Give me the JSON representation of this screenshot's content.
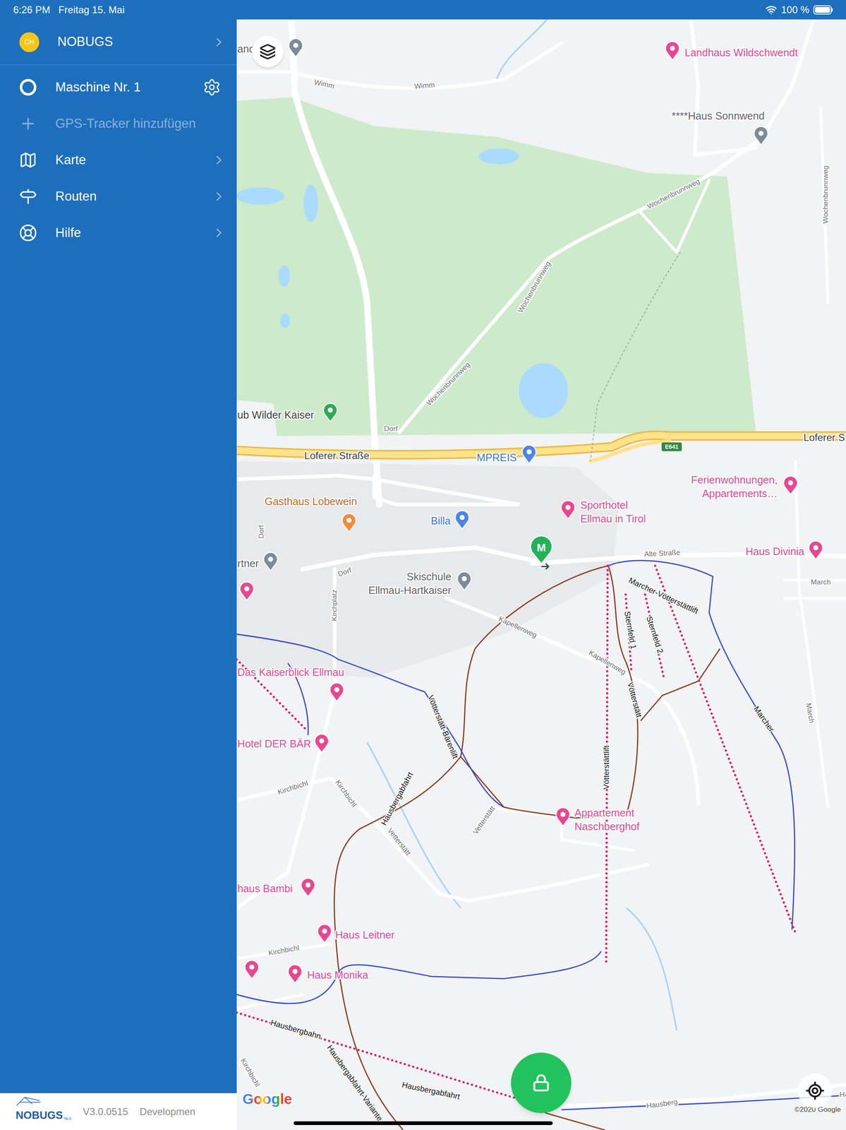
{
  "status_bar": {
    "time": "6:26 PM",
    "date": "Freitag 15. Mai",
    "battery": "100 %"
  },
  "sidebar": {
    "account": {
      "badge": "CH",
      "name": "NOBUGS"
    },
    "items": [
      {
        "label": "Maschine Nr. 1",
        "kind": "device",
        "disabled": false
      },
      {
        "label": "GPS-Tracker hinzufügen",
        "kind": "add",
        "disabled": true
      },
      {
        "label": "Karte",
        "kind": "map",
        "disabled": false
      },
      {
        "label": "Routen",
        "kind": "routes",
        "disabled": false
      },
      {
        "label": "Hilfe",
        "kind": "help",
        "disabled": false
      }
    ],
    "footer": {
      "logo": "NOBUGS",
      "logo_suffix": "NLS",
      "version": "V3.0.0515",
      "build": "Developmen"
    }
  },
  "map": {
    "marker": "M",
    "logo": "Google",
    "attribution": "©2020 Google",
    "labels": [
      {
        "text": "and",
        "kind": "place"
      },
      {
        "text": "Wimm",
        "kind": "road"
      },
      {
        "text": "Wimm",
        "kind": "road"
      },
      {
        "text": "Landhaus Wildschwendt",
        "kind": "lodging"
      },
      {
        "text": "****Haus Sonnwend",
        "kind": "place"
      },
      {
        "text": "Wochenbrunnweg",
        "kind": "road"
      },
      {
        "text": "Wochenbrunnweg",
        "kind": "road"
      },
      {
        "text": "Wochenbrunnweg",
        "kind": "road"
      },
      {
        "text": "Wochenbrunnweg",
        "kind": "road"
      },
      {
        "text": "ub Wilder Kaiser",
        "kind": "golf"
      },
      {
        "text": "Dorf",
        "kind": "road"
      },
      {
        "text": "Loferer Straße",
        "kind": "major_road"
      },
      {
        "text": "MPREIS",
        "kind": "shop"
      },
      {
        "text": "E641",
        "kind": "shield"
      },
      {
        "text": "Loferer S",
        "kind": "major_road"
      },
      {
        "text": "Ferienwohnungen,",
        "kind": "lodging"
      },
      {
        "text": "Appartements…",
        "kind": "lodging"
      },
      {
        "text": "Gasthaus Lobewein",
        "kind": "food"
      },
      {
        "text": "Sporthotel",
        "kind": "lodging"
      },
      {
        "text": "Ellmau in Tirol",
        "kind": "lodging"
      },
      {
        "text": "Billa",
        "kind": "shop"
      },
      {
        "text": "Dorf",
        "kind": "road"
      },
      {
        "text": "rtner",
        "kind": "place"
      },
      {
        "text": "Dorf",
        "kind": "road"
      },
      {
        "text": "Skischule",
        "kind": "place"
      },
      {
        "text": "Ellmau-Hartkaiser",
        "kind": "place"
      },
      {
        "text": "Alte Straße",
        "kind": "road"
      },
      {
        "text": "Haus Divinia",
        "kind": "lodging"
      },
      {
        "text": "March",
        "kind": "road"
      },
      {
        "text": "Kirchplatz",
        "kind": "road"
      },
      {
        "text": "Kapellenweg",
        "kind": "road"
      },
      {
        "text": "Kapellenweg",
        "kind": "road"
      },
      {
        "text": "Marcher-Vötterstättlift",
        "kind": "piste"
      },
      {
        "text": "Sternfeld 1",
        "kind": "piste"
      },
      {
        "text": "Sternfeld 2",
        "kind": "piste"
      },
      {
        "text": "Vötterstätt",
        "kind": "piste"
      },
      {
        "text": "Das Kaiserblick Ellmau",
        "kind": "lodging"
      },
      {
        "text": "Vötterstätt-Bärenlift",
        "kind": "piste"
      },
      {
        "text": "Marcher",
        "kind": "piste"
      },
      {
        "text": "March",
        "kind": "road"
      },
      {
        "text": "Hotel DER BÄR",
        "kind": "lodging"
      },
      {
        "text": "Vötterstättlift",
        "kind": "piste"
      },
      {
        "text": "Kirchbichl",
        "kind": "road"
      },
      {
        "text": "Kirchbichl",
        "kind": "road"
      },
      {
        "text": "Hausbergabfahrt",
        "kind": "piste"
      },
      {
        "text": "Vetterstätt",
        "kind": "road"
      },
      {
        "text": "Vetterstätt",
        "kind": "road"
      },
      {
        "text": "Appartement",
        "kind": "lodging"
      },
      {
        "text": "Naschberghof",
        "kind": "lodging"
      },
      {
        "text": "haus Bambi",
        "kind": "lodging"
      },
      {
        "text": "Haus Leitner",
        "kind": "lodging"
      },
      {
        "text": "Kirchbichl",
        "kind": "road"
      },
      {
        "text": "Haus Monika",
        "kind": "lodging"
      },
      {
        "text": "Hausbergbahn",
        "kind": "piste"
      },
      {
        "text": "Hausbergabfahrt-Variante",
        "kind": "piste"
      },
      {
        "text": "Hausbergabfahrt",
        "kind": "piste"
      },
      {
        "text": "Kirchbichl",
        "kind": "road"
      },
      {
        "text": "Hausberg",
        "kind": "road"
      },
      {
        "text": "H",
        "kind": "road"
      }
    ]
  }
}
